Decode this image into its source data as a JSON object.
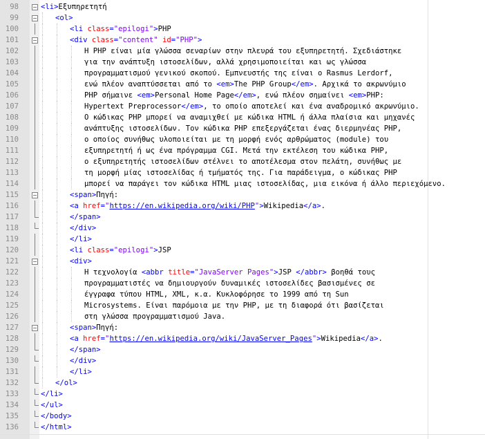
{
  "editor": {
    "lines": [
      {
        "no": "98",
        "fold": "box",
        "indent": 0,
        "parts": [
          [
            "tag",
            "<li>"
          ],
          [
            "txt",
            "Εξυπηρετητή"
          ]
        ]
      },
      {
        "no": "99",
        "fold": "box",
        "indent": 1,
        "parts": [
          [
            "tag",
            "<ol>"
          ]
        ]
      },
      {
        "no": "100",
        "fold": "line",
        "indent": 2,
        "parts": [
          [
            "tag",
            "<li "
          ],
          [
            "attr",
            "class"
          ],
          [
            "tag",
            "="
          ],
          [
            "str",
            "\"epilogi\""
          ],
          [
            "tag",
            ">"
          ],
          [
            "txt",
            "PHP"
          ]
        ]
      },
      {
        "no": "101",
        "fold": "box",
        "indent": 2,
        "parts": [
          [
            "tag",
            "<div "
          ],
          [
            "attr",
            "class"
          ],
          [
            "tag",
            "="
          ],
          [
            "str",
            "\"content\""
          ],
          [
            "tag",
            " "
          ],
          [
            "attr",
            "id"
          ],
          [
            "tag",
            "="
          ],
          [
            "str",
            "\"PHP\""
          ],
          [
            "tag",
            ">"
          ]
        ]
      },
      {
        "no": "102",
        "fold": "line",
        "indent": 3,
        "parts": [
          [
            "txt",
            "Η PHP είναι μία γλώσσα σεναρίων στην πλευρά του εξυπηρετητή. Σχεδιάστηκε"
          ]
        ]
      },
      {
        "no": "103",
        "fold": "line",
        "indent": 3,
        "parts": [
          [
            "txt",
            "για την ανάπτυξη ιστοσελίδων, αλλά χρησιμοποιείται και ως γλώσσα"
          ]
        ]
      },
      {
        "no": "104",
        "fold": "line",
        "indent": 3,
        "parts": [
          [
            "txt",
            "προγραμματισμού γενικού σκοπού. Εμπνευστής της είναι ο Rasmus Lerdorf,"
          ]
        ]
      },
      {
        "no": "105",
        "fold": "line",
        "indent": 3,
        "parts": [
          [
            "txt",
            "ενώ πλέον αναπτύσσεται από το "
          ],
          [
            "tag",
            "<em>"
          ],
          [
            "txt",
            "The PHP Group"
          ],
          [
            "tag",
            "</em>"
          ],
          [
            "txt",
            ". Αρχικά το ακρωνύμιο"
          ]
        ]
      },
      {
        "no": "106",
        "fold": "line",
        "indent": 3,
        "parts": [
          [
            "txt",
            "PHP σήμαινε "
          ],
          [
            "tag",
            "<em>"
          ],
          [
            "txt",
            "Personal Home Page"
          ],
          [
            "tag",
            "</em>"
          ],
          [
            "txt",
            ", ενώ πλέον σημαίνει "
          ],
          [
            "tag",
            "<em>"
          ],
          [
            "txt",
            "PHP:"
          ]
        ]
      },
      {
        "no": "107",
        "fold": "line",
        "indent": 3,
        "parts": [
          [
            "txt",
            "Hypertext Preprocessor"
          ],
          [
            "tag",
            "</em>"
          ],
          [
            "txt",
            ", το οποίο αποτελεί και ένα αναδρομικό ακρωνύμιο."
          ]
        ]
      },
      {
        "no": "108",
        "fold": "line",
        "indent": 3,
        "parts": [
          [
            "txt",
            "Ο κώδικας PHP μπορεί να αναμιχθεί με κώδικα HTML ή άλλα πλαίσια και μηχανές"
          ]
        ]
      },
      {
        "no": "109",
        "fold": "line",
        "indent": 3,
        "parts": [
          [
            "txt",
            "ανάπτυξης ιστοσελίδων. Τον κώδικα PHP επεξεργάζεται ένας διερμηνέας PHP,"
          ]
        ]
      },
      {
        "no": "110",
        "fold": "line",
        "indent": 3,
        "parts": [
          [
            "txt",
            "ο οποίος συνήθως υλοποιείται με τη μορφή ενός αρθρώματος (module) του"
          ]
        ]
      },
      {
        "no": "111",
        "fold": "line",
        "indent": 3,
        "parts": [
          [
            "txt",
            "εξυπηρετητή ή ως ένα πρόγραμμα CGI. Μετά την εκτέλεση του κώδικα PHP,"
          ]
        ]
      },
      {
        "no": "112",
        "fold": "line",
        "indent": 3,
        "parts": [
          [
            "txt",
            "ο εξυπηρετητής ιστοσελίδων στέλνει το αποτέλεσμα στον πελάτη, συνήθως με"
          ]
        ]
      },
      {
        "no": "113",
        "fold": "line",
        "indent": 3,
        "parts": [
          [
            "txt",
            "τη μορφή μίας ιστοσελίδας ή τμήματός της. Για παράδειγμα, ο κώδικας PHP"
          ]
        ]
      },
      {
        "no": "114",
        "fold": "line",
        "indent": 3,
        "parts": [
          [
            "txt",
            "μπορεί να παράγει τον κώδικα HTML μιας ιστοσελίδας, μια εικόνα ή άλλο περιεχόμενο."
          ]
        ]
      },
      {
        "no": "115",
        "fold": "box",
        "indent": 2,
        "parts": [
          [
            "tag",
            "<span>"
          ],
          [
            "txt",
            "Πηγή:"
          ]
        ]
      },
      {
        "no": "116",
        "fold": "line",
        "indent": 2,
        "parts": [
          [
            "tag",
            "<a "
          ],
          [
            "attr",
            "href"
          ],
          [
            "tag",
            "="
          ],
          [
            "str",
            "\""
          ],
          [
            "url",
            "https://en.wikipedia.org/wiki/PHP"
          ],
          [
            "str",
            "\""
          ],
          [
            "tag",
            ">"
          ],
          [
            "txt",
            "Wikipedia"
          ],
          [
            "tag",
            "</a>"
          ],
          [
            "txt",
            "."
          ]
        ]
      },
      {
        "no": "117",
        "fold": "end",
        "indent": 2,
        "parts": [
          [
            "tag",
            "</span>"
          ]
        ]
      },
      {
        "no": "118",
        "fold": "end",
        "indent": 2,
        "parts": [
          [
            "tag",
            "</div>"
          ]
        ]
      },
      {
        "no": "119",
        "fold": "line",
        "indent": 2,
        "parts": [
          [
            "tag",
            "</li>"
          ]
        ]
      },
      {
        "no": "120",
        "fold": "line",
        "indent": 2,
        "parts": [
          [
            "tag",
            "<li "
          ],
          [
            "attr",
            "class"
          ],
          [
            "tag",
            "="
          ],
          [
            "str",
            "\"epilogi\""
          ],
          [
            "tag",
            ">"
          ],
          [
            "txt",
            "JSP"
          ]
        ]
      },
      {
        "no": "121",
        "fold": "box",
        "indent": 2,
        "parts": [
          [
            "tag",
            "<div>"
          ]
        ]
      },
      {
        "no": "122",
        "fold": "line",
        "indent": 3,
        "parts": [
          [
            "txt",
            "Η τεχνολογία "
          ],
          [
            "tag",
            "<abbr "
          ],
          [
            "attr",
            "title"
          ],
          [
            "tag",
            "="
          ],
          [
            "str",
            "\"JavaServer Pages\""
          ],
          [
            "tag",
            ">"
          ],
          [
            "txt",
            "JSP "
          ],
          [
            "tag",
            "</abbr>"
          ],
          [
            "txt",
            " βοηθά τους"
          ]
        ]
      },
      {
        "no": "123",
        "fold": "line",
        "indent": 3,
        "parts": [
          [
            "txt",
            "προγραμματιστές να δημιουργούν δυναμικές ιστοσελίδες βασισμένες σε"
          ]
        ]
      },
      {
        "no": "124",
        "fold": "line",
        "indent": 3,
        "parts": [
          [
            "txt",
            "έγγραφα τύπου HTML, XML, κ.α. Κυκλοφόρησε το 1999 από τη Sun"
          ]
        ]
      },
      {
        "no": "125",
        "fold": "line",
        "indent": 3,
        "parts": [
          [
            "txt",
            "Microsystems. Είναι παρόμοια με την PHP, με τη διαφορά ότι βασίζεται"
          ]
        ]
      },
      {
        "no": "126",
        "fold": "line",
        "indent": 3,
        "parts": [
          [
            "txt",
            "στη γλώσσα προγραμματισμού Java."
          ]
        ]
      },
      {
        "no": "127",
        "fold": "box",
        "indent": 2,
        "parts": [
          [
            "tag",
            "<span>"
          ],
          [
            "txt",
            "Πηγή:"
          ]
        ]
      },
      {
        "no": "128",
        "fold": "line",
        "indent": 2,
        "parts": [
          [
            "tag",
            "<a "
          ],
          [
            "attr",
            "href"
          ],
          [
            "tag",
            "="
          ],
          [
            "str",
            "\""
          ],
          [
            "url",
            "https://en.wikipedia.org/wiki/JavaServer_Pages"
          ],
          [
            "str",
            "\""
          ],
          [
            "tag",
            ">"
          ],
          [
            "txt",
            "Wikipedia"
          ],
          [
            "tag",
            "</a>"
          ],
          [
            "txt",
            "."
          ]
        ]
      },
      {
        "no": "129",
        "fold": "end",
        "indent": 2,
        "parts": [
          [
            "tag",
            "</span>"
          ]
        ]
      },
      {
        "no": "130",
        "fold": "end",
        "indent": 2,
        "parts": [
          [
            "tag",
            "</div>"
          ]
        ]
      },
      {
        "no": "131",
        "fold": "line",
        "indent": 2,
        "parts": [
          [
            "tag",
            "</li>"
          ]
        ]
      },
      {
        "no": "132",
        "fold": "end",
        "indent": 1,
        "parts": [
          [
            "tag",
            "</ol>"
          ]
        ]
      },
      {
        "no": "133",
        "fold": "end",
        "indent": 0,
        "parts": [
          [
            "tag",
            "</li>"
          ]
        ]
      },
      {
        "no": "134",
        "fold": "end",
        "indent": 0,
        "parts": [
          [
            "tag",
            "</ul>"
          ]
        ]
      },
      {
        "no": "135",
        "fold": "end",
        "indent": 0,
        "parts": [
          [
            "tag",
            "</body>"
          ]
        ]
      },
      {
        "no": "136",
        "fold": "end",
        "indent": 0,
        "parts": [
          [
            "tag",
            "</html>"
          ]
        ]
      }
    ]
  }
}
